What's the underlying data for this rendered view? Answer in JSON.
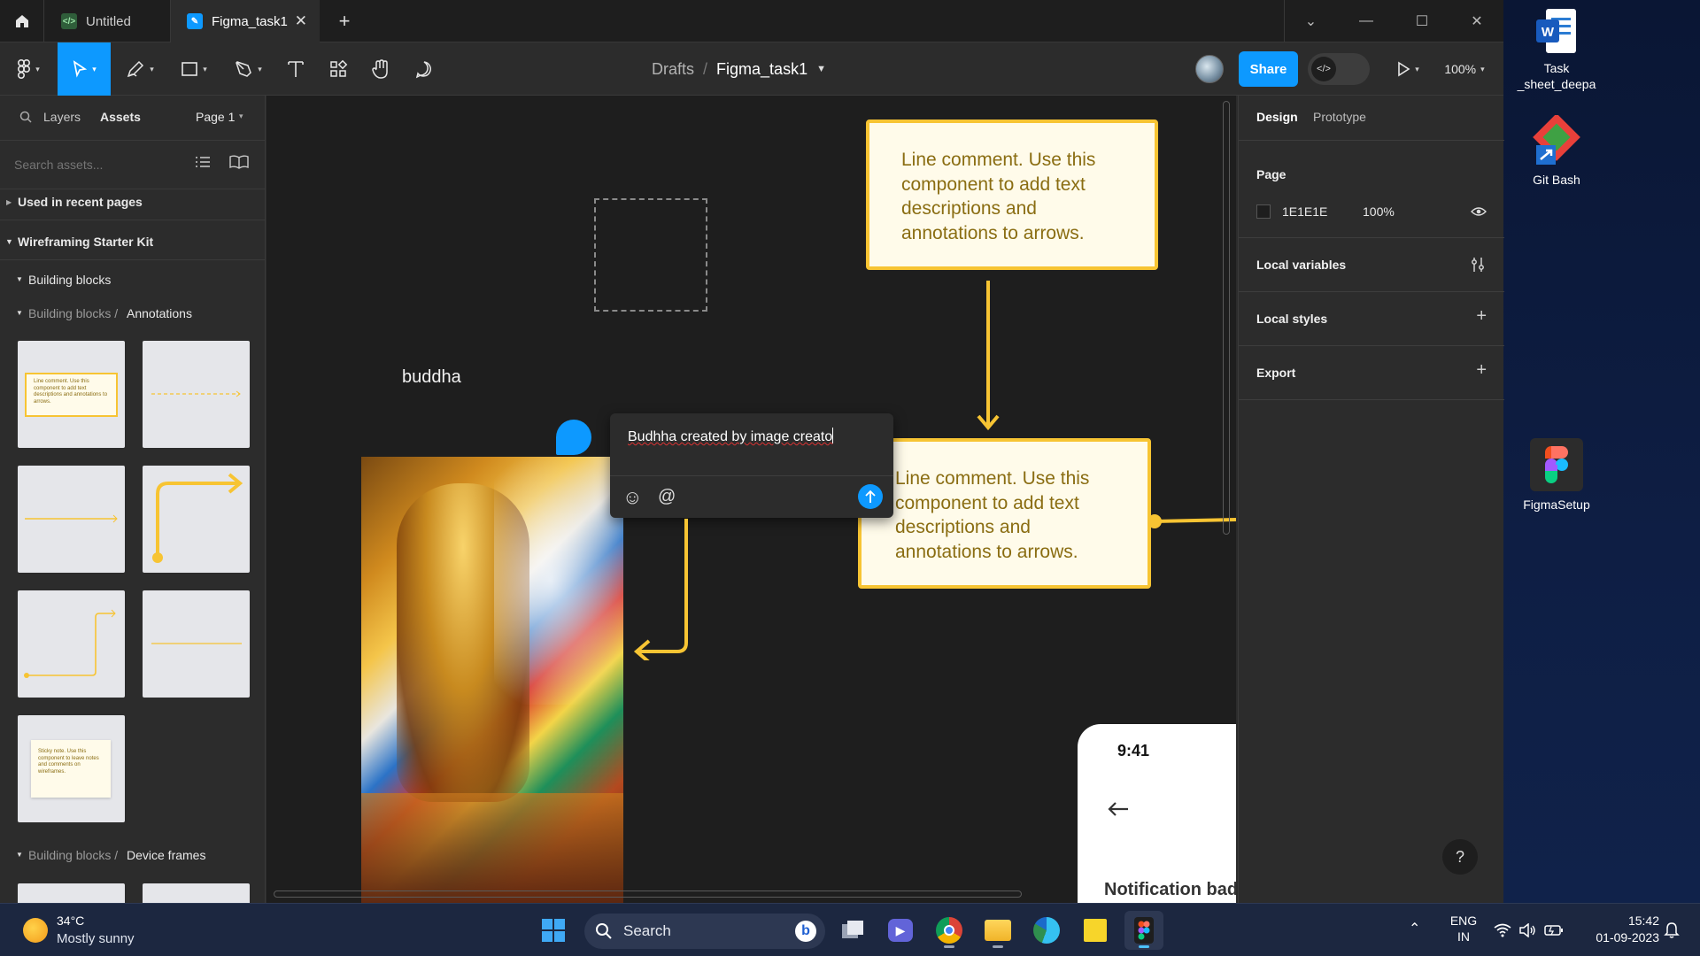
{
  "tabs": [
    {
      "label": "Untitled",
      "icon": "code-file-icon",
      "active": false
    },
    {
      "label": "Figma_task1",
      "icon": "figma-file-icon",
      "active": true
    }
  ],
  "toolbar": {
    "breadcrumb_root": "Drafts",
    "breadcrumb_sep": "/",
    "file_name": "Figma_task1",
    "share_label": "Share",
    "zoom": "100%"
  },
  "left_panel": {
    "tab_layers": "Layers",
    "tab_assets": "Assets",
    "page_selector": "Page 1",
    "search_placeholder": "Search assets...",
    "section_recent": "Used in recent pages",
    "section_kit": "Wireframing Starter Kit",
    "group_building_blocks": "Building blocks",
    "group_annotations_parent": "Building blocks /",
    "group_annotations": "Annotations",
    "group_device_parent": "Building blocks /",
    "group_device": "Device frames",
    "thumb_line_comment": "Line comment. Use this component to add text descriptions and annotations to arrows.",
    "thumb_sticky_note": "Sticky note. Use this component to leave notes and comments on wireframes."
  },
  "canvas": {
    "buddha_label": "buddha",
    "callout_top": "Line comment. Use this component to add text descriptions and annotations to arrows.",
    "callout_bottom": "Line comment. Use this component to add text descriptions and annotations to arrows.",
    "comment_text": "Budhha created by image creato",
    "phone_time": "9:41",
    "phone_heading": "Notification bad",
    "help": "?"
  },
  "right_panel": {
    "tab_design": "Design",
    "tab_prototype": "Prototype",
    "page_heading": "Page",
    "page_color_hex": "1E1E1E",
    "page_opacity": "100%",
    "local_variables": "Local variables",
    "local_styles": "Local styles",
    "export": "Export"
  },
  "desktop_icons": [
    {
      "label": "Task _sheet_deepa",
      "icon": "word-document-icon"
    },
    {
      "label": "Git Bash",
      "icon": "git-bash-icon"
    },
    {
      "label": "FigmaSetup",
      "icon": "figma-setup-icon"
    }
  ],
  "taskbar": {
    "weather_temp": "34°C",
    "weather_desc": "Mostly sunny",
    "search_label": "Search",
    "lang_top": "ENG",
    "lang_bottom": "IN",
    "time": "15:42",
    "date": "01-09-2023"
  },
  "colors": {
    "accent_blue": "#0d99ff",
    "callout_border": "#f7c433",
    "callout_text": "#8a6d12",
    "canvas_bg": "#1e1e1e",
    "panel_bg": "#2c2c2c"
  }
}
